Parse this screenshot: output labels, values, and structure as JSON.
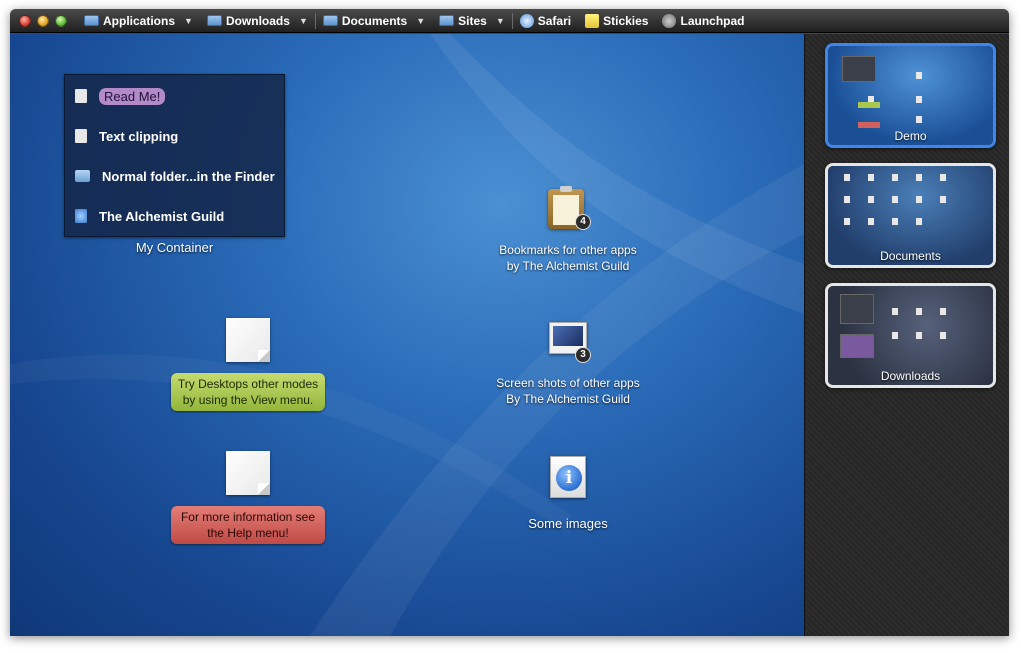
{
  "toolbar": {
    "items": [
      {
        "label": "Applications",
        "icon": "folder-applications-icon",
        "dropdown": true
      },
      {
        "label": "Downloads",
        "icon": "folder-downloads-icon",
        "dropdown": true
      },
      {
        "label": "Documents",
        "icon": "folder-icon",
        "dropdown": true
      },
      {
        "label": "Sites",
        "icon": "folder-icon",
        "dropdown": true
      },
      {
        "label": "Safari",
        "icon": "safari-icon",
        "dropdown": false
      },
      {
        "label": "Stickies",
        "icon": "stickies-icon",
        "dropdown": false
      },
      {
        "label": "Launchpad",
        "icon": "launchpad-icon",
        "dropdown": false
      }
    ],
    "dropdown_glyph": "▼"
  },
  "container": {
    "title": "My Container",
    "items": [
      {
        "label": "Read Me!",
        "icon": "document-icon",
        "highlight": "#b38ac8"
      },
      {
        "label": "Text clipping",
        "icon": "text-clipping-icon"
      },
      {
        "label": "Normal folder...in the Finder",
        "icon": "folder-icon"
      },
      {
        "label": "The Alchemist Guild",
        "icon": "web-location-icon"
      }
    ]
  },
  "desktop": {
    "bookmarks": {
      "label": "Bookmarks for other apps by The Alchemist Guild",
      "badge": "4",
      "icon": "clipboard-icon"
    },
    "screenshots": {
      "label": "Screen shots of other apps By The Alchemist Guild",
      "badge": "3",
      "icon": "screenshots-icon"
    },
    "images": {
      "label": "Some images",
      "icon": "info-icon",
      "glyph": "i"
    },
    "note_view": {
      "text": "Try Desktops other modes by using the View menu.",
      "color": "#a9c64e"
    },
    "note_help": {
      "text": "For more information see the Help menu!",
      "color": "#d2615c"
    }
  },
  "sidebar": {
    "desktops": [
      {
        "name": "Demo",
        "active": true
      },
      {
        "name": "Documents",
        "active": false
      },
      {
        "name": "Downloads",
        "active": false
      }
    ]
  },
  "colors": {
    "accent": "#3f86ea",
    "desktop_blue": "#1a4f96",
    "read_me_label": "#b38ac8"
  }
}
